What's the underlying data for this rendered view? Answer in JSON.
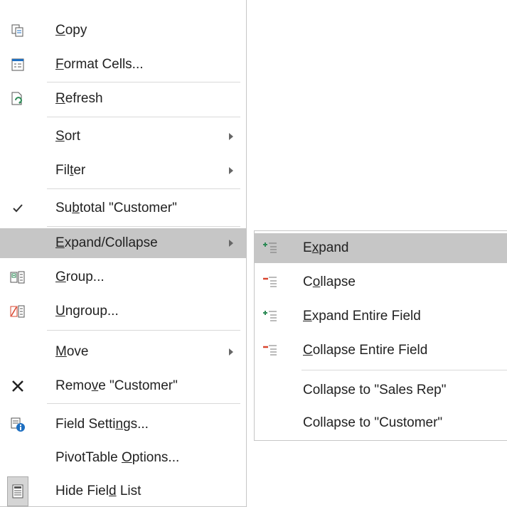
{
  "main_menu": {
    "items": [
      {
        "icon": "copy-icon",
        "pre": "",
        "acc": "C",
        "post": "opy",
        "submenu": false
      },
      {
        "icon": "format-cells-icon",
        "pre": "",
        "acc": "F",
        "post": "ormat Cells...",
        "submenu": false
      },
      {
        "icon": "refresh-icon",
        "pre": "",
        "acc": "R",
        "post": "efresh",
        "submenu": false
      },
      {
        "icon": "",
        "pre": "",
        "acc": "S",
        "post": "ort",
        "submenu": true
      },
      {
        "icon": "",
        "pre": "Fil",
        "acc": "t",
        "post": "er",
        "submenu": true
      },
      {
        "icon": "checkmark-icon",
        "pre": "Su",
        "acc": "b",
        "post": "total \"Customer\"",
        "submenu": false
      },
      {
        "icon": "",
        "pre": "",
        "acc": "E",
        "post": "xpand/Collapse",
        "submenu": true
      },
      {
        "icon": "group-icon",
        "pre": "",
        "acc": "G",
        "post": "roup...",
        "submenu": false
      },
      {
        "icon": "ungroup-icon",
        "pre": "",
        "acc": "U",
        "post": "ngroup...",
        "submenu": false
      },
      {
        "icon": "",
        "pre": "",
        "acc": "M",
        "post": "ove",
        "submenu": true
      },
      {
        "icon": "remove-x-icon",
        "pre": "Remo",
        "acc": "v",
        "post": "e \"Customer\"",
        "submenu": false
      },
      {
        "icon": "field-settings-icon",
        "pre": "Field Setti",
        "acc": "n",
        "post": "gs...",
        "submenu": false
      },
      {
        "icon": "",
        "pre": "PivotTable ",
        "acc": "O",
        "post": "ptions...",
        "submenu": false
      },
      {
        "icon": "field-list-icon",
        "pre": "Hide Fiel",
        "acc": "d",
        "post": " List",
        "submenu": false
      }
    ]
  },
  "sub_menu": {
    "items": [
      {
        "icon": "expand-icon",
        "pre": "E",
        "acc": "x",
        "post": "pand"
      },
      {
        "icon": "collapse-icon",
        "pre": "C",
        "acc": "o",
        "post": "llapse"
      },
      {
        "icon": "expand-entire-field-icon",
        "pre": "",
        "acc": "E",
        "post": "xpand Entire Field"
      },
      {
        "icon": "collapse-entire-field-icon",
        "pre": "",
        "acc": "C",
        "post": "ollapse Entire Field"
      },
      {
        "icon": "",
        "pre": "Collapse to \"Sales Rep\"",
        "acc": "",
        "post": ""
      },
      {
        "icon": "",
        "pre": "Collapse to \"Customer\"",
        "acc": "",
        "post": ""
      }
    ]
  },
  "colors": {
    "highlight": "#c6c6c6",
    "green": "#2e8b57",
    "red": "#d9452e",
    "blue": "#1e6fc1"
  }
}
